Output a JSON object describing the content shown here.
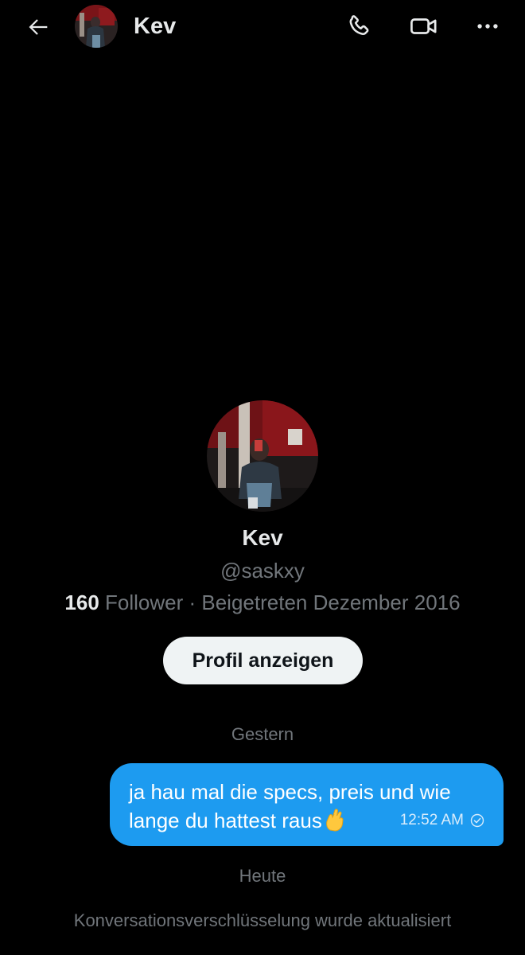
{
  "header": {
    "back_icon": "arrow-left-icon",
    "name": "Kev",
    "call_icon": "phone-icon",
    "video_icon": "video-camera-icon",
    "more_icon": "more-horizontal-icon"
  },
  "profile": {
    "name": "Kev",
    "handle": "@saskxy",
    "follower_count": "160",
    "follower_label": " Follower · Beigetreten Dezember 2016",
    "view_profile_label": "Profil anzeigen"
  },
  "conversation": {
    "day_yesterday": "Gestern",
    "message": {
      "line1": "ja hau mal die specs, preis und wie",
      "line2": "lange du hattest raus",
      "emoji": "crossed-fingers-icon",
      "time": "12:52 AM",
      "status_icon": "check-circle-icon"
    },
    "day_today": "Heute",
    "system_message": "Konversationsverschlüsselung wurde aktualisiert"
  },
  "colors": {
    "background": "#000000",
    "primary_text": "#e7e9ea",
    "secondary_text": "#71767b",
    "bubble": "#1d9bf0",
    "button_bg": "#eff3f4",
    "button_text": "#0f1419"
  }
}
